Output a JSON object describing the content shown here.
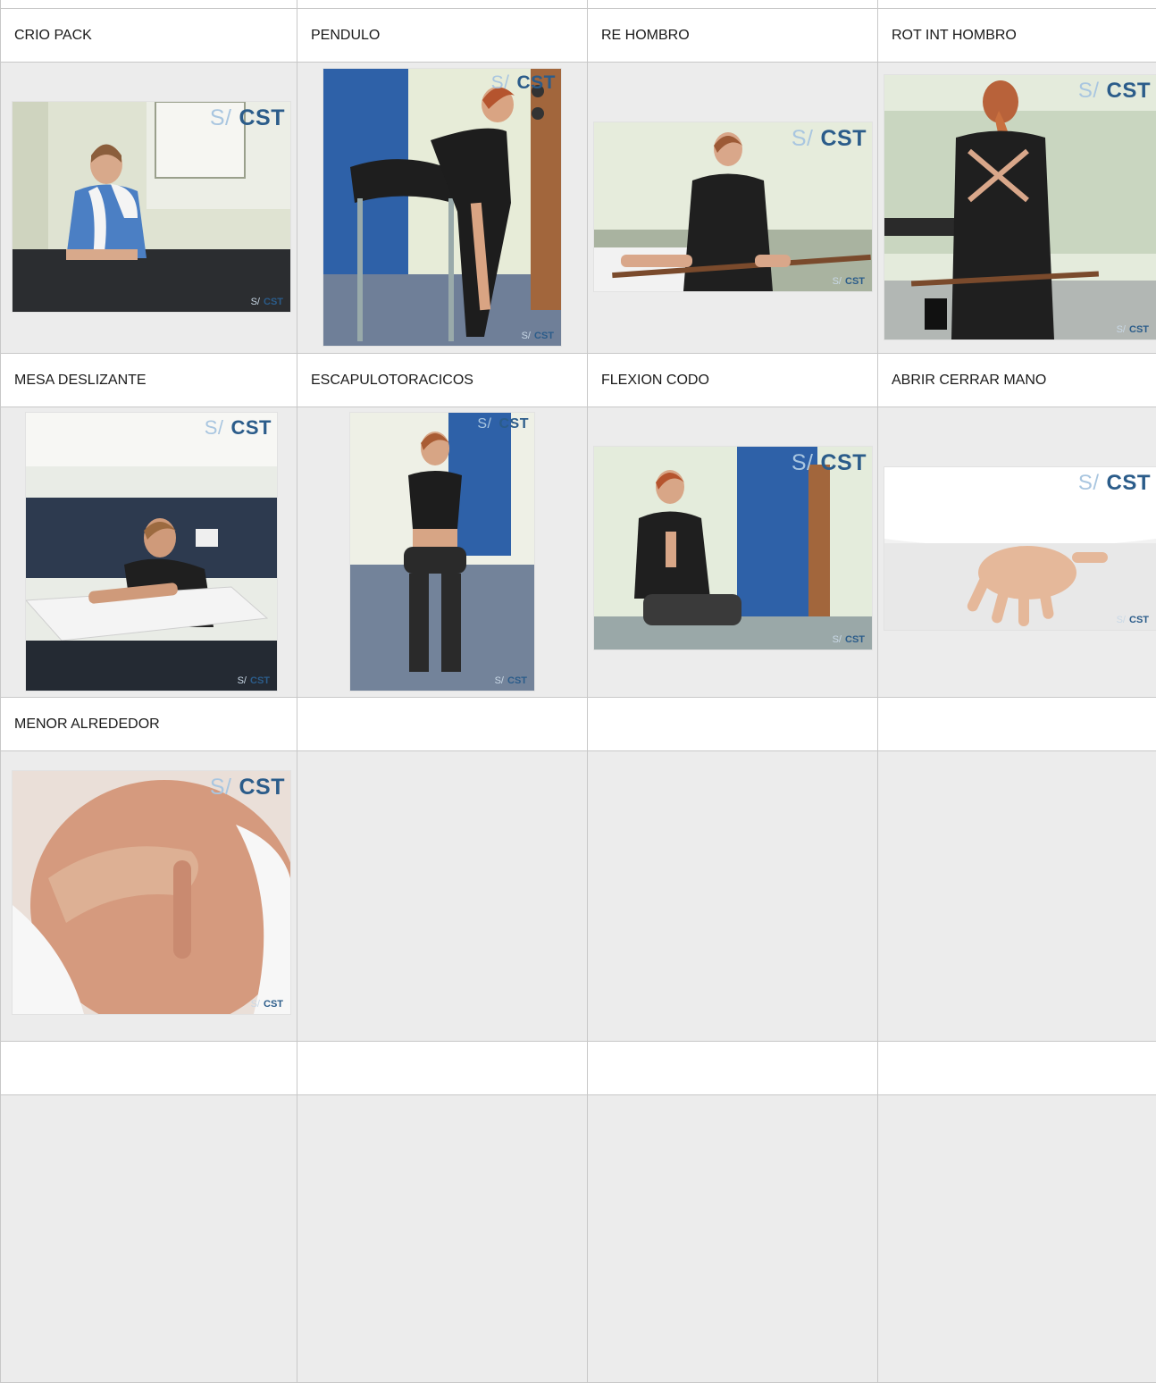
{
  "rows": [
    {
      "kind": "labels",
      "labels": [
        "CRIO PACK",
        "PENDULO",
        "RE HOMBRO",
        "ROT INT HOMBRO"
      ]
    },
    {
      "kind": "photos",
      "photos": [
        "person-with-towel-photo",
        "pendulum-exercise-photo",
        "external-rotation-stick-photo",
        "internal-rotation-stick-photo"
      ]
    },
    {
      "kind": "labels",
      "labels": [
        "MESA DESLIZANTE",
        "ESCAPULOTORACICOS",
        "FLEXION CODO",
        "ABRIR CERRAR MANO"
      ]
    },
    {
      "kind": "photos",
      "photos": [
        "sliding-table-photo",
        "seated-scapular-photo",
        "elbow-flexion-photo",
        "open-close-hand-photo"
      ]
    },
    {
      "kind": "labels",
      "labels": [
        "MENOR ALREDEDOR",
        "",
        "",
        ""
      ]
    },
    {
      "kind": "photos",
      "photos": [
        "hand-massage-photo",
        "",
        "",
        ""
      ]
    },
    {
      "kind": "labels",
      "labels": [
        "",
        "",
        "",
        ""
      ]
    },
    {
      "kind": "photos",
      "photos": [
        "",
        "",
        "",
        ""
      ]
    }
  ],
  "watermark": {
    "slash": "S/",
    "brand": "CST"
  },
  "colors": {
    "grid": "#c8c8c8",
    "photo_cell_bg": "#ececec",
    "brand_blue": "#2b5c8a"
  }
}
